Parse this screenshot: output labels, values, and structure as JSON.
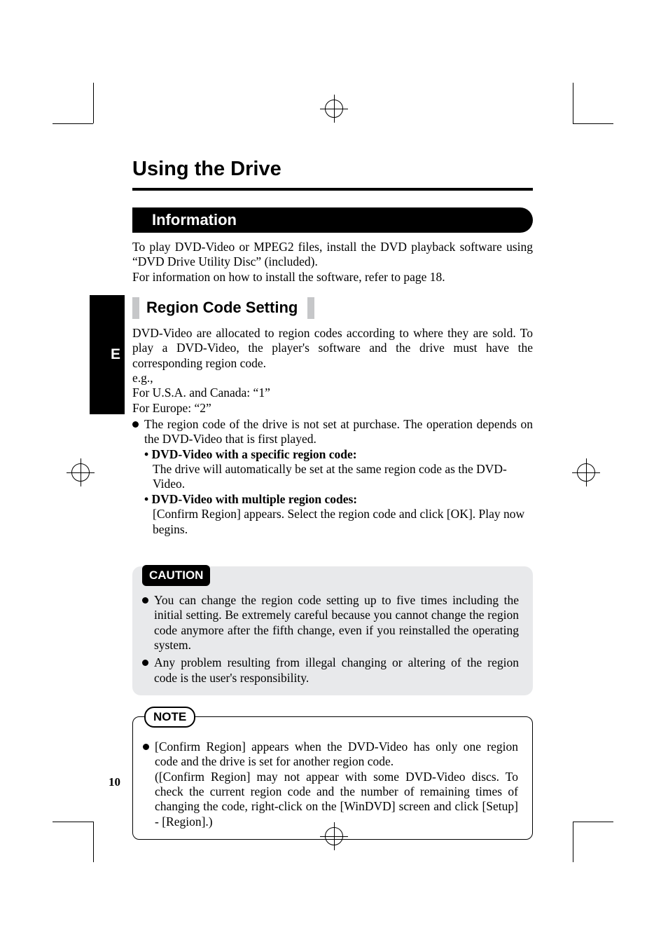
{
  "sideTab": "E",
  "pageTitle": "Using the Drive",
  "sectionTitle": "Information",
  "introPara": "To play DVD-Video or MPEG2 files, install the DVD playback software using “DVD Drive Utility Disc” (included).\nFor information on how to install the software, refer to page 18.",
  "subsectionTitle": "Region Code Setting",
  "regionPara1": "DVD-Video are allocated to region codes according to where they are sold. To play a DVD-Video, the player's software and the drive must have the corresponding region code.",
  "regionEg": "e.g.,",
  "regionUsa": "For U.S.A. and Canada: “1”",
  "regionEurope": "For Europe: “2”",
  "bullet1Text": "The region code of the drive is not set at purchase. The operation depends on the DVD-Video that is first played.",
  "sub1Label": "• DVD-Video with a specific region code:",
  "sub1Text": "The drive will automatically be set at the same region code as the DVD-Video.",
  "sub2Label": "• DVD-Video with multiple region codes:",
  "sub2Text": "[Confirm Region] appears. Select the region code and click [OK]. Play now begins.",
  "cautionLabel": "CAUTION",
  "caution1": "You can change the region code setting up to five times including the initial setting. Be extremely careful because you cannot change the region code anymore after the fifth change, even if you reinstalled the operating system.",
  "caution2": "Any problem resulting from illegal changing or altering of the region code is the user's responsibility.",
  "noteLabel": "NOTE",
  "note1": "[Confirm Region] appears when the DVD-Video has only one region code and the drive is set for another region code.",
  "note2": "([Confirm Region] may not appear with some DVD-Video discs. To check the current region code and the number of remaining times of changing the code, right-click on the [WinDVD] screen and click [Setup] - [Region].)",
  "pageNumber": "10"
}
